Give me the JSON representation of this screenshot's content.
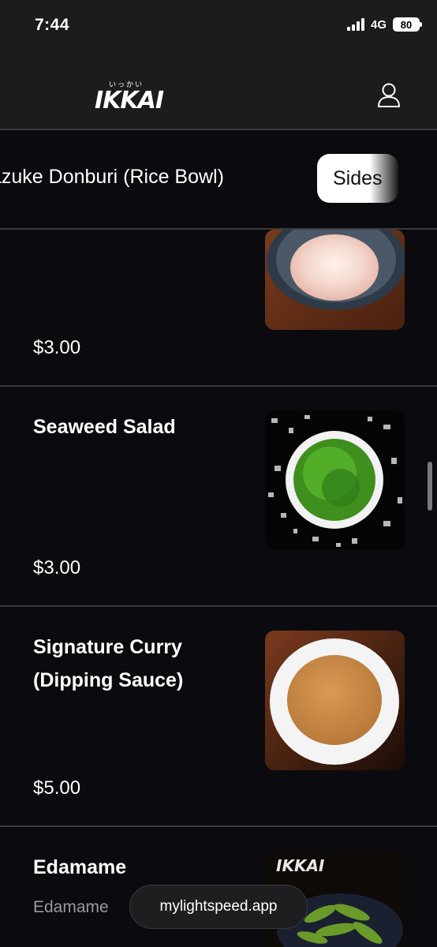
{
  "status_bar": {
    "time": "7:44",
    "network": "4G",
    "battery": "80"
  },
  "header": {
    "logo_small": "いっかい",
    "logo_main": "IKKAI"
  },
  "categories": {
    "previous": "Chazuke Donburi (Rice Bowl)",
    "previous_visible": "azuke Donburi (Rice Bowl)",
    "active": "Sides"
  },
  "menu": {
    "items": [
      {
        "name": "",
        "description": "",
        "price": "$3.00",
        "image": "onsen-egg-bowl"
      },
      {
        "name": "Seaweed Salad",
        "description": "",
        "price": "$3.00",
        "image": "seaweed-salad-bowl"
      },
      {
        "name": "Signature Curry (Dipping Sauce)",
        "description": "",
        "price": "$5.00",
        "image": "curry-sauce-bowl"
      },
      {
        "name": "Edamame",
        "description": "Edamame",
        "price": "",
        "image": "edamame-bowl"
      }
    ]
  },
  "browser": {
    "url": "mylightspeed.app"
  },
  "colors": {
    "background": "#0b0b0f",
    "header": "#1c1c1e",
    "divider": "#3a3a3c",
    "muted_text": "#9a9a9e"
  }
}
